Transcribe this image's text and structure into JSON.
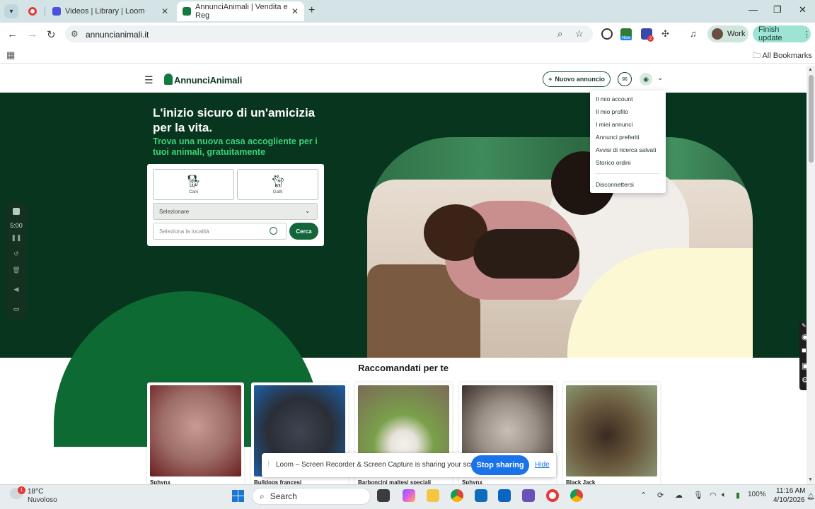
{
  "browser": {
    "tabs": [
      {
        "title": "",
        "active": false
      },
      {
        "title": "Videos | Library | Loom",
        "active": false
      },
      {
        "title": "AnnunciAnimali | Vendita e Reg",
        "active": true
      }
    ],
    "url": "annuncianimali.it",
    "profile_label": "Work",
    "finish_update_label": "Finish update",
    "ext_new_badge": "New",
    "ext_count_badge": "2",
    "all_bookmarks_label": "All Bookmarks"
  },
  "site": {
    "logo_text": "AnnunciAnimali",
    "new_ad_label": "Nuovo annuncio",
    "hero": {
      "title": "L'inizio sicuro di un'amicizia per la vita.",
      "subtitle": "Trova una nuova casa accogliente per i tuoi animali, gratuitamente"
    },
    "search": {
      "options": [
        {
          "label": "Cani",
          "icon": "dog-icon"
        },
        {
          "label": "Gatti",
          "icon": "cat-icon"
        }
      ],
      "select_value": "Selezionare",
      "location_placeholder": "Seleziona la località",
      "search_button": "Cerca"
    },
    "account_menu": [
      "Il mio account",
      "Il mio profilo",
      "I miei annunci",
      "Annunci preferiti",
      "Avvisi di ricerca salvati",
      "Storico ordini",
      "Disconnettersi"
    ],
    "recommendations": {
      "title": "Raccomandati per te",
      "cards": [
        {
          "name": "Sphynx"
        },
        {
          "name": "Bulldogs francesi"
        },
        {
          "name": "Barboncini maltesi speciali"
        },
        {
          "name": "Sphynx"
        },
        {
          "name": "Black Jack"
        }
      ]
    }
  },
  "loom": {
    "timer": "5:00",
    "share_text": "Loom – Screen Recorder & Screen Capture is sharing your screen.",
    "stop_label": "Stop sharing",
    "hide_label": "Hide"
  },
  "taskbar": {
    "weather_badge": "1",
    "temperature": "18°C",
    "weather": "Nuvoloso",
    "search_label": "Search",
    "battery": "100%",
    "time": "11:16 AM",
    "date": "4/10/2026"
  },
  "colors": {
    "brand_dark": "#07351d",
    "brand_green": "#12663a",
    "accent_green": "#3dd27a",
    "cream": "#fcf8d4",
    "loom_blue": "#1a73e8"
  }
}
